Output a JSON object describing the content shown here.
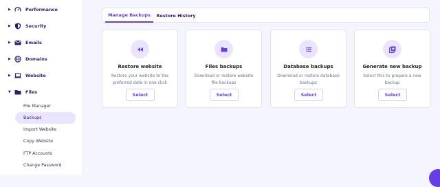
{
  "colors": {
    "accent": "#673de6",
    "sidebar_active_bg": "#ebe4ff",
    "icon_bg": "#ebe4ff"
  },
  "sidebar": {
    "items": [
      {
        "label": "Performance",
        "icon": "gauge-icon"
      },
      {
        "label": "Security",
        "icon": "shield-icon"
      },
      {
        "label": "Emails",
        "icon": "envelope-icon"
      },
      {
        "label": "Domains",
        "icon": "globe-icon"
      },
      {
        "label": "Website",
        "icon": "laptop-icon"
      },
      {
        "label": "Files",
        "icon": "folder-icon"
      }
    ],
    "sub_items": [
      "File Manager",
      "Backups",
      "Import Website",
      "Copy Website",
      "FTP Accounts",
      "Change Password"
    ],
    "active_sub_item": "Backups"
  },
  "tabs": [
    {
      "label": "Manage Backups",
      "active": true
    },
    {
      "label": "Restore History",
      "active": false
    }
  ],
  "cards": [
    {
      "title": "Restore website",
      "description": "Restore your website to the preferred date in one click",
      "button": "Select",
      "icon": "rewind-icon"
    },
    {
      "title": "Files backups",
      "description": "Download or restore website file backups",
      "button": "Select",
      "icon": "folder-icon"
    },
    {
      "title": "Database backups",
      "description": "Download or restore database backups",
      "button": "Select",
      "icon": "database-list-icon"
    },
    {
      "title": "Generate new backup",
      "description": "Select this to prepare a new backup",
      "button": "Select",
      "icon": "add-backup-icon"
    }
  ]
}
